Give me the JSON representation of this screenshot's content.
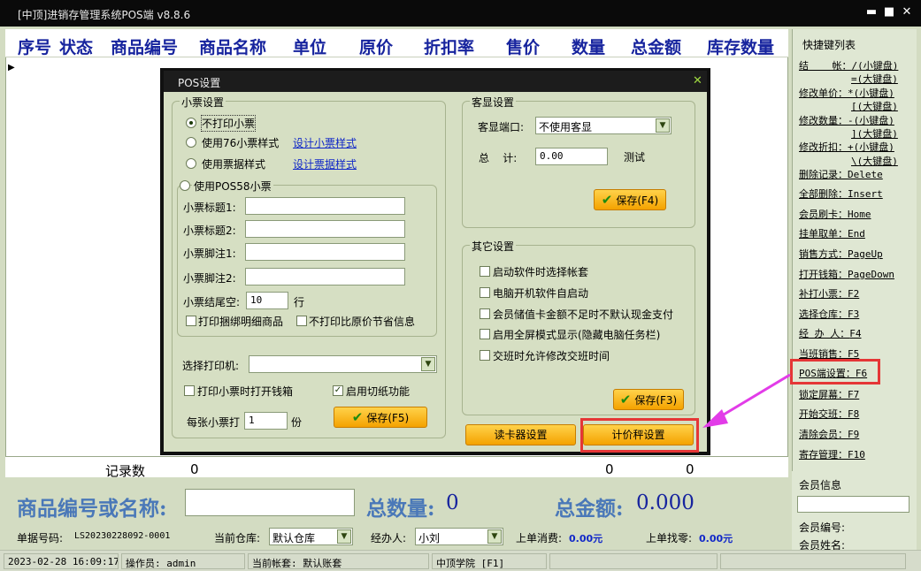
{
  "window": {
    "title": "[中顶]进销存管理系统POS端 v8.8.6",
    "minimize": "▬",
    "maximize": "■",
    "close": "✕"
  },
  "grid": {
    "columns": [
      "序号",
      "状态",
      "商品编号",
      "商品名称",
      "单位",
      "原价",
      "折扣率",
      "售价",
      "数量",
      "总金额",
      "库存数量"
    ],
    "row_marker": "▶",
    "totals": {
      "label": "记录数",
      "count": "0",
      "qty": "0",
      "amount": "0"
    }
  },
  "sidebar": {
    "title": "快捷键列表",
    "items": [
      {
        "label": "结    帐：",
        "key": "/(小键盘)",
        "key2": "=(大键盘)"
      },
      {
        "label": "修改单价：",
        "key": "*(小键盘)",
        "key2": "[(大键盘)"
      },
      {
        "label": "修改数量：",
        "key": "-(小键盘)",
        "key2": "](大键盘)"
      },
      {
        "label": "修改折扣：",
        "key": "+(小键盘)",
        "key2": "\\(大键盘)"
      },
      {
        "label": "删除记录：",
        "key": "Delete"
      },
      {
        "label": "全部删除：",
        "key": "Insert"
      },
      {
        "label": "会员刷卡：",
        "key": "Home"
      },
      {
        "label": "挂单取单：",
        "key": "End"
      },
      {
        "label": "销售方式：",
        "key": "PageUp"
      },
      {
        "label": "打开钱箱：",
        "key": "PageDown"
      },
      {
        "label": "补打小票：",
        "key": "F2"
      },
      {
        "label": "选择仓库：",
        "key": "F3"
      },
      {
        "label": "经 办 人：",
        "key": "F4"
      },
      {
        "label": "当班销售：",
        "key": "F5"
      },
      {
        "label": "POS端设置：",
        "key": "F6"
      },
      {
        "label": "锁定屏幕：",
        "key": "F7"
      },
      {
        "label": "开始交班：",
        "key": "F8"
      },
      {
        "label": "清除会员：",
        "key": "F9"
      },
      {
        "label": "寄存管理：",
        "key": "F10"
      }
    ]
  },
  "member": {
    "title": "会员信息",
    "card_value": "",
    "no_label": "会员编号:",
    "name_label": "会员姓名:"
  },
  "entry": {
    "product_label": "商品编号或名称:",
    "product_value": "",
    "qty_label": "总数量:",
    "qty_value": "0",
    "amount_label": "总金额:",
    "amount_value": "0.000"
  },
  "info": {
    "order_label": "单据号码:",
    "order_value": "LS20230228092-0001",
    "warehouse_label": "当前仓库:",
    "warehouse_value": "默认仓库",
    "handler_label": "经办人:",
    "handler_value": "小刘",
    "last_spend_label": "上单消费:",
    "last_spend_value": "0.00元",
    "last_change_label": "上单找零:",
    "last_change_value": "0.00元"
  },
  "status": {
    "datetime": "2023-02-28 16:09:17",
    "operator": "操作员: admin",
    "account": "当前帐套: 默认账套",
    "school": "中顶学院 [F1]"
  },
  "dialog": {
    "title": "POS设置",
    "close": "✕",
    "ticket": {
      "group": "小票设置",
      "radio_none": "不打印小票",
      "radio_76": "使用76小票样式",
      "link_76": "设计小票样式",
      "radio_bill": "使用票据样式",
      "link_bill": "设计票据样式",
      "radio_58": "使用POS58小票",
      "title1_label": "小票标题1:",
      "title1_value": "",
      "title2_label": "小票标题2:",
      "title2_value": "",
      "foot1_label": "小票脚注1:",
      "foot1_value": "",
      "foot2_label": "小票脚注2:",
      "foot2_value": "",
      "tail_label": "小票结尾空:",
      "tail_value": "10",
      "tail_unit": "行",
      "cb_bundle": "打印捆绑明细商品",
      "cb_nosave": "不打印比原价节省信息"
    },
    "printer": {
      "label": "选择打印机:",
      "value": "",
      "cb_drawer": "打印小票时打开钱箱",
      "cb_drawer_checked": false,
      "cb_cut": "启用切纸功能",
      "cb_cut_checked": true,
      "copies_label": "每张小票打",
      "copies_value": "1",
      "copies_unit": "份",
      "save": "保存(F5)"
    },
    "display": {
      "group": "客显设置",
      "port_label": "客显端口:",
      "port_value": "不使用客显",
      "total_label": "总    计:",
      "total_value": "0.00",
      "test": "测试",
      "save": "保存(F4)"
    },
    "other": {
      "group": "其它设置",
      "options": [
        "启动软件时选择帐套",
        "电脑开机软件自启动",
        "会员储值卡金额不足时不默认现金支付",
        "启用全屏模式显示(隐藏电脑任务栏)",
        "交班时允许修改交班时间"
      ],
      "save": "保存(F3)"
    },
    "card_reader": "读卡器设置",
    "scale": "计价秤设置"
  },
  "colors": {
    "accent": "#17249e",
    "highlight": "#e53636",
    "arrow": "#e23ce8",
    "button": "#f4a200"
  }
}
